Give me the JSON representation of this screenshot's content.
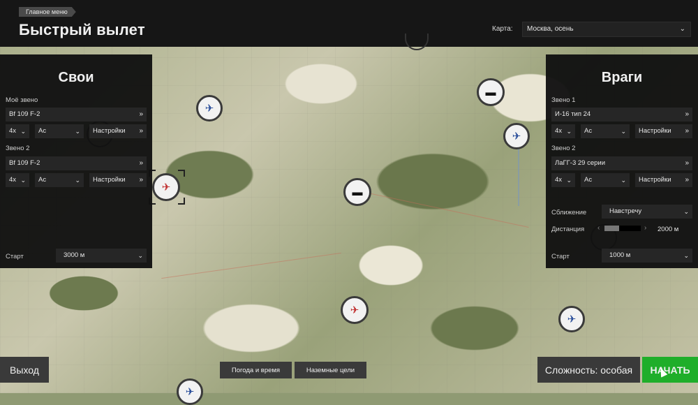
{
  "header": {
    "breadcrumb": "Главное меню",
    "title": "Быстрый вылет",
    "map_label": "Карта:",
    "map_value": "Москва, осень"
  },
  "friendly": {
    "title": "Свои",
    "flight1_label": "Моё звено",
    "flight1_aircraft": "Bf 109 F-2",
    "flight1_count": "4x",
    "flight1_skill": "Ас",
    "flight1_settings": "Настройки",
    "flight2_label": "Звено 2",
    "flight2_aircraft": "Bf 109 F-2",
    "flight2_count": "4x",
    "flight2_skill": "Ас",
    "flight2_settings": "Настройки",
    "start_label": "Старт",
    "start_value": "3000 м"
  },
  "enemy": {
    "title": "Враги",
    "flight1_label": "Звено 1",
    "flight1_aircraft": "И-16 тип 24",
    "flight1_count": "4x",
    "flight1_skill": "Ас",
    "flight1_settings": "Настройки",
    "flight2_label": "Звено 2",
    "flight2_aircraft": "ЛаГГ-3 29 серии",
    "flight2_count": "4x",
    "flight2_skill": "Ас",
    "flight2_settings": "Настройки",
    "approach_label": "Сближение",
    "approach_value": "Навстречу",
    "distance_label": "Дистанция",
    "distance_value": "2000 м",
    "distance_level": 0.4,
    "start_label": "Старт",
    "start_value": "1000 м"
  },
  "icons": {
    "arrow": "»",
    "chevron": "⌄",
    "plane": "✈",
    "tank": "▬"
  },
  "buttons": {
    "exit": "Выход",
    "weather": "Погода и время",
    "ground_targets": "Наземные цели",
    "difficulty": "Сложность: особая",
    "start": "НАЧАТЬ"
  },
  "colors": {
    "start_button": "#1fae2a",
    "friendly_marker": "#c03030",
    "enemy_marker": "#2a4e9a"
  }
}
